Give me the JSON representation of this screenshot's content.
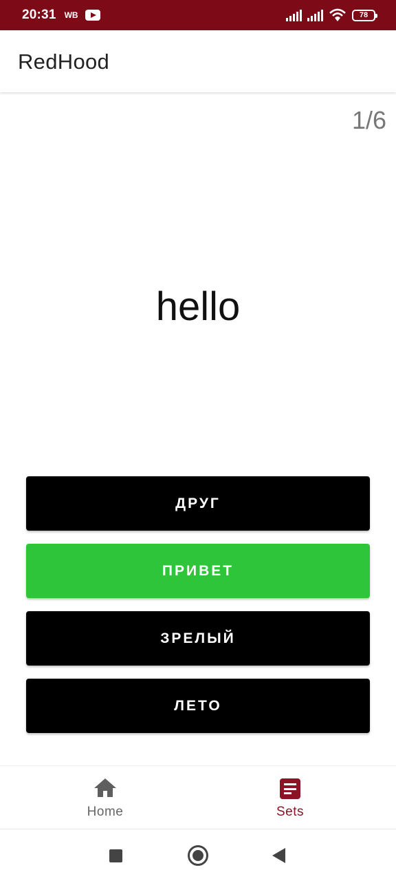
{
  "status_bar": {
    "time": "20:31",
    "carrier_tag": "WB",
    "battery_level": "78",
    "icons": [
      "youtube-icon",
      "signal-icon",
      "signal-icon",
      "wifi-icon",
      "battery-icon"
    ]
  },
  "app_bar": {
    "title": "RedHood"
  },
  "quiz": {
    "progress": "1/6",
    "word": "hello",
    "answers": [
      {
        "label": "ДРУГ",
        "state": "default"
      },
      {
        "label": "ПРИВЕТ",
        "state": "correct"
      },
      {
        "label": "ЗРЕЛЫЙ",
        "state": "default"
      },
      {
        "label": "ЛЕТО",
        "state": "default"
      }
    ]
  },
  "bottom_nav": {
    "items": [
      {
        "label": "Home",
        "icon": "home-icon",
        "active": false
      },
      {
        "label": "Sets",
        "icon": "list-icon",
        "active": true
      }
    ]
  },
  "colors": {
    "status_bar": "#7d0a17",
    "accent": "#8c1326",
    "correct": "#2ec53a",
    "button": "#000000"
  }
}
